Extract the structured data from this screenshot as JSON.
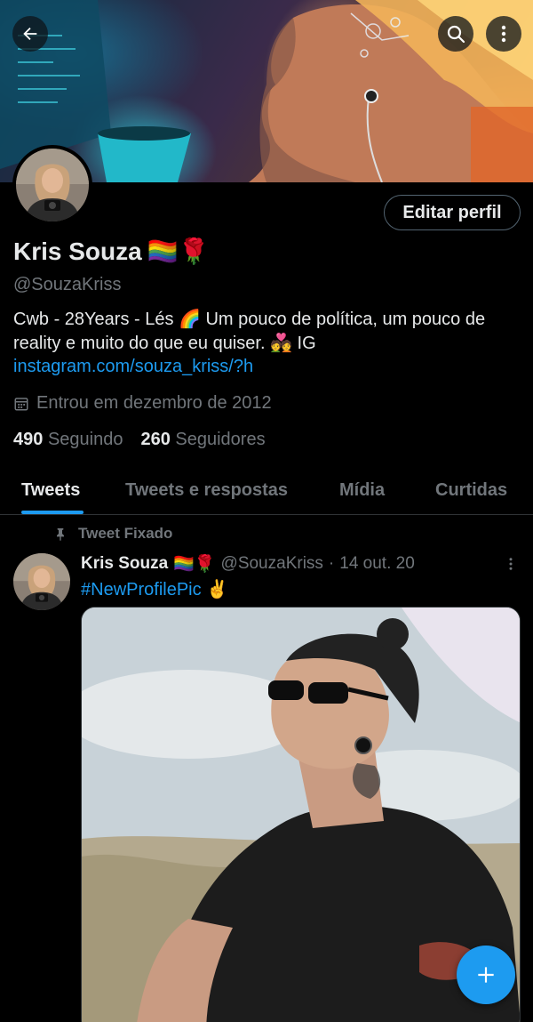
{
  "header": {
    "back_icon": "arrow-left-icon",
    "search_icon": "search-icon",
    "more_icon": "more-vertical-icon"
  },
  "profile": {
    "name": "Kris Souza",
    "name_emoji": "🏳️‍🌈🌹",
    "handle": "@SouzaKriss",
    "edit_button": "Editar perfil",
    "bio_text": "Cwb - 28Years - Lés 🌈 Um pouco de política, um pouco de reality e muito do que eu quiser. 💑 IG ",
    "bio_link": "instagram.com/souza_kriss/?h",
    "joined": "Entrou em dezembro de 2012",
    "following_count": "490",
    "following_label": "Seguindo",
    "followers_count": "260",
    "followers_label": "Seguidores"
  },
  "tabs": [
    {
      "label": "Tweets",
      "active": true
    },
    {
      "label": "Tweets e respostas",
      "active": false
    },
    {
      "label": "Mídia",
      "active": false
    },
    {
      "label": "Curtidas",
      "active": false
    }
  ],
  "tweet": {
    "pinned_label": "Tweet Fixado",
    "author_name": "Kris Souza",
    "author_emoji": "🏳️‍🌈🌹",
    "author_handle": "@SouzaKriss",
    "separator": "·",
    "date": "14 out. 20",
    "text": "#NewProfilePic ✌️"
  },
  "fab": {
    "icon": "plus-icon"
  },
  "colors": {
    "accent": "#1d9bf0",
    "background": "#000000",
    "primary_text": "#e7e9ea",
    "secondary_text": "#71767b",
    "border": "#2f3336"
  }
}
